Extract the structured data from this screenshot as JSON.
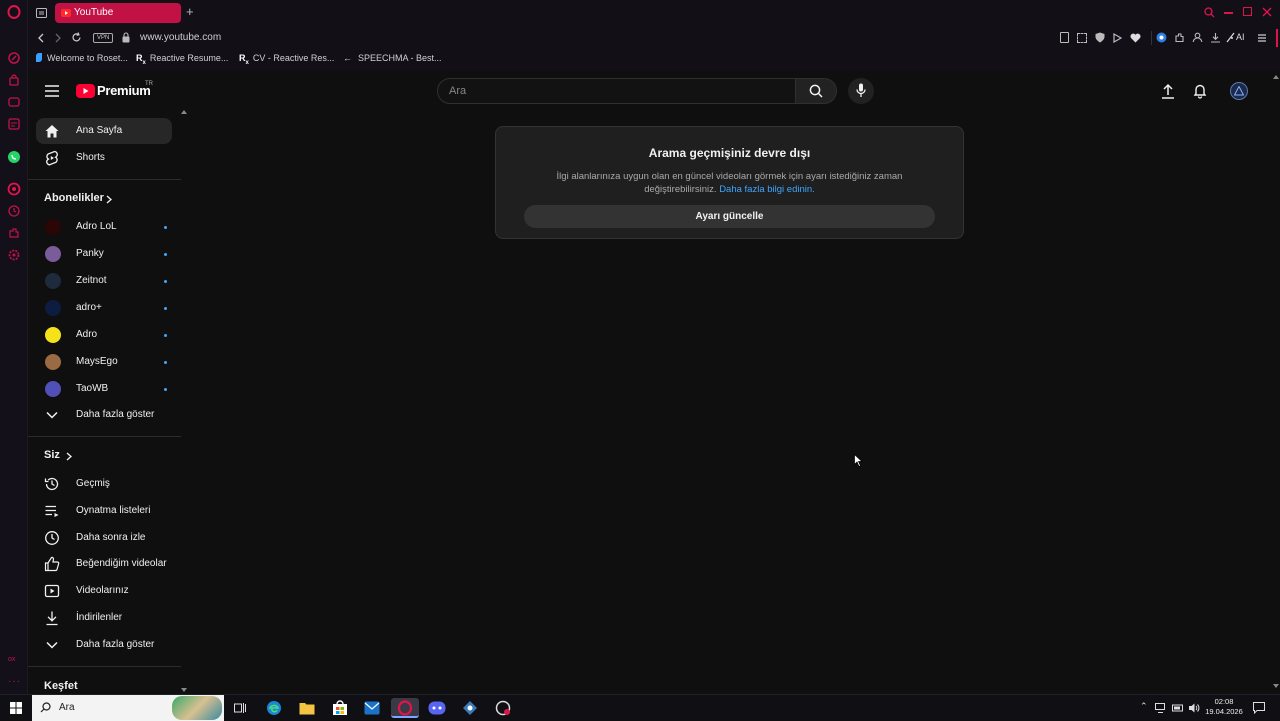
{
  "browser": {
    "tab_title": "YouTube",
    "url": "www.youtube.com",
    "vpn_label": "VPN",
    "ai_label": "AI",
    "bookmarks": [
      {
        "label": "Welcome to Roset..."
      },
      {
        "label": "Reactive Resume..."
      },
      {
        "label": "CV - Reactive Res..."
      },
      {
        "label": "SPEECHMA - Best..."
      }
    ],
    "accent_color": "#e0144c"
  },
  "youtube": {
    "logo_text": "Premium",
    "country_code": "TR",
    "search_placeholder": "Ara",
    "sidebar": {
      "main": [
        {
          "label": "Ana Sayfa",
          "icon": "home-icon",
          "active": true
        },
        {
          "label": "Shorts",
          "icon": "shorts-icon"
        }
      ],
      "subscriptions_title": "Abonelikler",
      "subscriptions": [
        {
          "label": "Adro LoL",
          "color": "#3a0a0a"
        },
        {
          "label": "Panky",
          "color": "#6a4c8a"
        },
        {
          "label": "Zeitnot",
          "color": "#1a2a3a"
        },
        {
          "label": "adro+",
          "color": "#0a1a3a"
        },
        {
          "label": "Adro",
          "color": "#f4e21a"
        },
        {
          "label": "MaysEgo",
          "color": "#8a5a3a"
        },
        {
          "label": "TaoWB",
          "color": "#4a4aaa"
        }
      ],
      "subscriptions_more": "Daha fazla göster",
      "you_title": "Siz",
      "you_items": [
        {
          "label": "Geçmiş",
          "icon": "history-icon"
        },
        {
          "label": "Oynatma listeleri",
          "icon": "playlist-icon"
        },
        {
          "label": "Daha sonra izle",
          "icon": "watch-later-icon"
        },
        {
          "label": "Beğendiğim videolar",
          "icon": "like-icon"
        },
        {
          "label": "Videolarınız",
          "icon": "your-videos-icon"
        },
        {
          "label": "İndirilenler",
          "icon": "download-icon"
        },
        {
          "label": "Daha fazla göster",
          "icon": "chevron-down-icon"
        }
      ],
      "explore_title": "Keşfet"
    },
    "notice": {
      "title": "Arama geçmişiniz devre dışı",
      "body": "İlgi alanlarınıza uygun olan en güncel videoları görmek için ayarı istediğiniz zaman değiştirebilirsiniz.",
      "link": "Daha fazla bilgi edinin.",
      "button": "Ayarı güncelle"
    }
  },
  "taskbar": {
    "search_placeholder": "Ara",
    "time": "02:08",
    "date": "19.04.2026"
  }
}
